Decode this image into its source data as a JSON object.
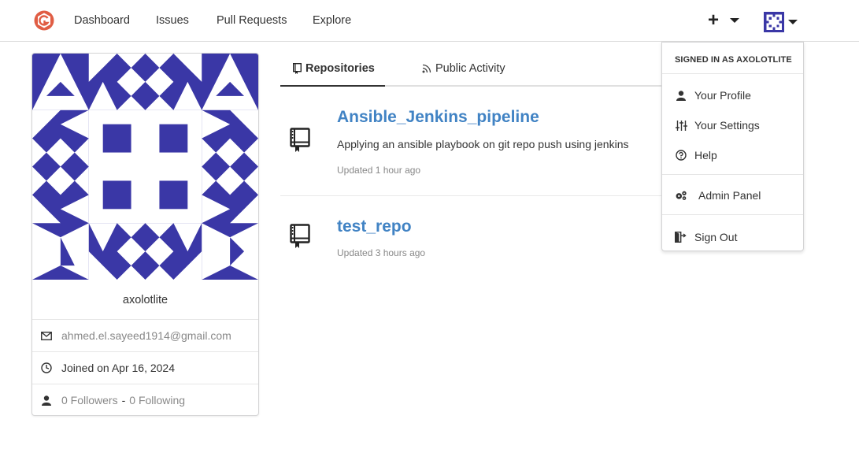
{
  "nav": {
    "links": [
      "Dashboard",
      "Issues",
      "Pull Requests",
      "Explore"
    ],
    "plus_label": "+"
  },
  "profile": {
    "username": "axolotlite",
    "email": "ahmed.el.sayeed1914@gmail.com",
    "joined": "Joined on Apr 16, 2024",
    "followers": "0 Followers",
    "separator": "-",
    "following": "0 Following",
    "identicon_color": "#3a37a6"
  },
  "tabs": [
    {
      "label": "Repositories",
      "active": true,
      "icon": "repo-icon"
    },
    {
      "label": "Public Activity",
      "active": false,
      "icon": "rss-icon"
    }
  ],
  "repos": [
    {
      "name": "Ansible_Jenkins_pipeline",
      "description": "Applying an ansible playbook on git repo push using jenkins",
      "updated": "Updated 1 hour ago"
    },
    {
      "name": "test_repo",
      "description": "",
      "updated": "Updated 3 hours ago"
    }
  ],
  "dropdown": {
    "header": "SIGNED IN AS AXOLOTLITE",
    "items": [
      {
        "label": "Your Profile",
        "icon": "person-icon"
      },
      {
        "label": "Your Settings",
        "icon": "settings-icon"
      },
      {
        "label": "Help",
        "icon": "question-icon"
      },
      {
        "label": "Admin Panel",
        "icon": "server-icon"
      },
      {
        "label": "Sign Out",
        "icon": "sign-out-icon"
      }
    ]
  },
  "colors": {
    "link": "#4183c4",
    "logo": "#e05d44",
    "identicon": "#3a37a6"
  }
}
